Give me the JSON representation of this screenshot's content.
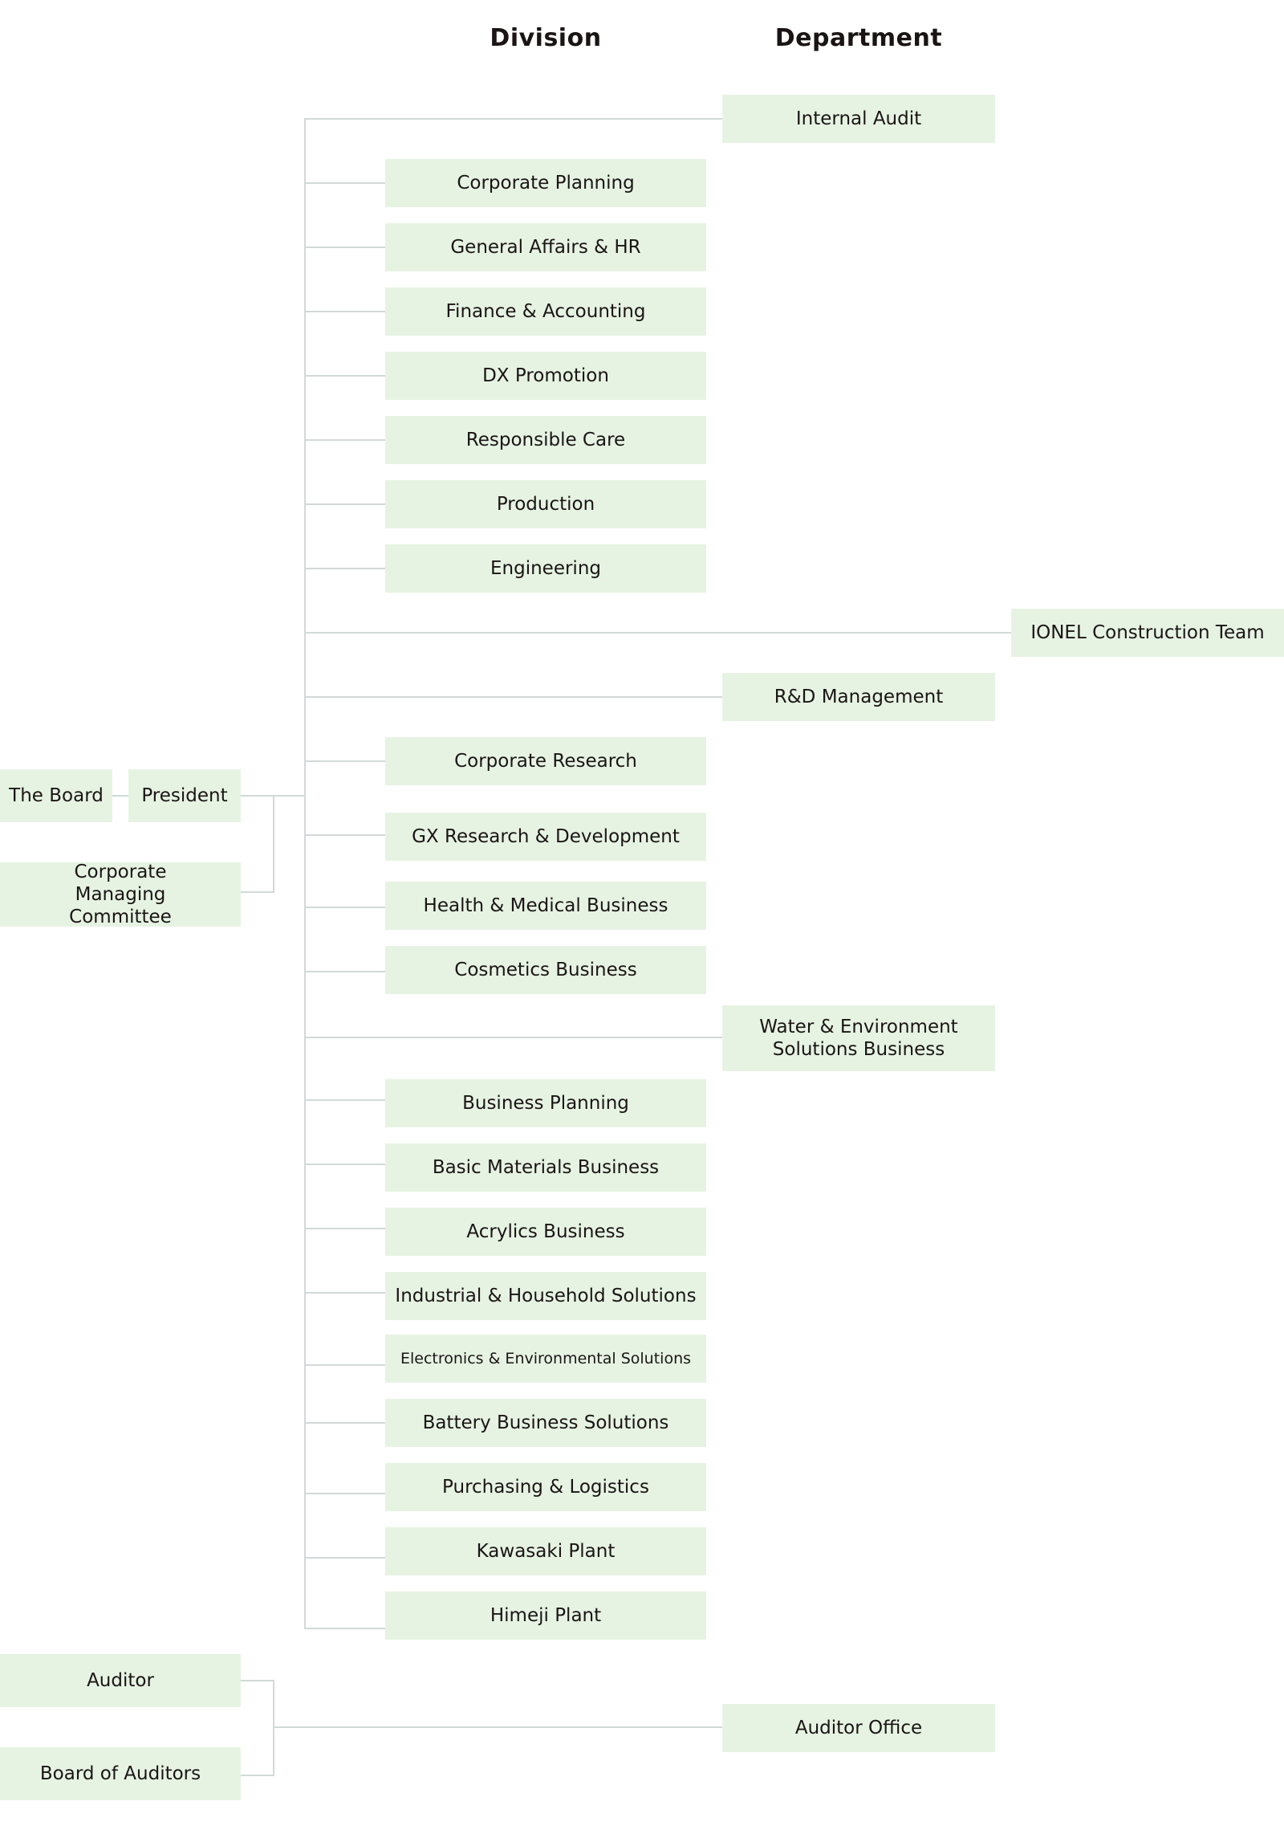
{
  "headers": {
    "division": "Division",
    "department": "Department"
  },
  "left": {
    "the_board": "The Board",
    "president": "President",
    "corporate_managing_committee": "Corporate Managing Committee",
    "auditor": "Auditor",
    "board_of_auditors": "Board of Auditors"
  },
  "departments": {
    "internal_audit": "Internal Audit",
    "ionel_construction_team": "IONEL Construction Team",
    "rd_management": "R&D Management",
    "water_environment": "Water & Environment Solutions Business",
    "auditor_office": "Auditor Office"
  },
  "divisions": [
    "Corporate Planning",
    "General Affairs & HR",
    "Finance & Accounting",
    "DX Promotion",
    "Responsible Care",
    "Production",
    "Engineering",
    "Corporate Research",
    "GX Research & Development",
    "Health & Medical Business",
    "Cosmetics Business",
    "Business Planning",
    "Basic Materials Business",
    "Acrylics Business",
    "Industrial & Household Solutions",
    "Electronics & Environmental Solutions",
    "Battery Business Solutions",
    "Purchasing & Logistics",
    "Kawasaki Plant",
    "Himeji Plant"
  ],
  "colors": {
    "box_fill": "#e6f3e3",
    "connector": "#d3d8d8",
    "text": "#1a1514"
  }
}
